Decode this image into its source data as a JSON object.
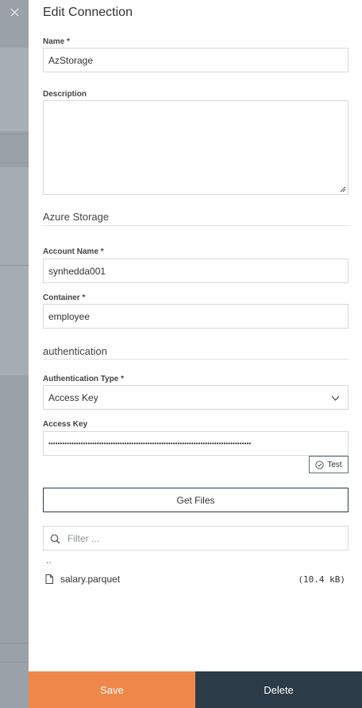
{
  "panel": {
    "title": "Edit Connection",
    "close_icon": "close-icon"
  },
  "form": {
    "name": {
      "label": "Name *",
      "value": "AzStorage"
    },
    "description": {
      "label": "Description",
      "value": ""
    },
    "azure_section_title": "Azure Storage",
    "account_name": {
      "label": "Account Name *",
      "value": "synhedda001"
    },
    "container": {
      "label": "Container *",
      "value": "employee"
    },
    "auth_section_title": "authentication",
    "auth_type": {
      "label": "Authentication Type *",
      "value": "Access Key"
    },
    "access_key": {
      "label": "Access Key",
      "value": "••••••••••••••••••••••••••••••••••••••••••••••••••••••••••••••••••••••••••••••••••••••••"
    },
    "test_label": "Test",
    "get_files_label": "Get Files"
  },
  "files": {
    "filter_placeholder": "Filter ...",
    "parent_dir": "..",
    "items": [
      {
        "name": "salary.parquet",
        "size": "(10.4 kB)"
      }
    ]
  },
  "footer": {
    "save_label": "Save",
    "delete_label": "Delete"
  },
  "colors": {
    "save": "#f0874a",
    "delete": "#2b3b47",
    "overlay": "#a3a9b0"
  }
}
